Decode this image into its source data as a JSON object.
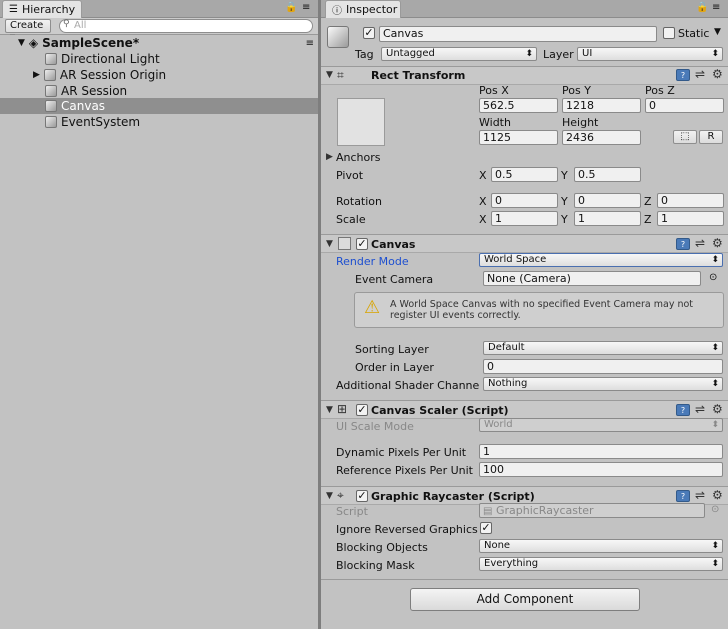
{
  "hierarchy": {
    "tab_label": "Hierarchy",
    "create_label": "Create",
    "search_placeholder": "All",
    "scene_name": "SampleScene*",
    "items": [
      {
        "label": "Directional Light"
      },
      {
        "label": "AR Session Origin"
      },
      {
        "label": "AR Session"
      },
      {
        "label": "Canvas"
      },
      {
        "label": "EventSystem"
      }
    ]
  },
  "inspector": {
    "tab_label": "Inspector",
    "object_name": "Canvas",
    "static_label": "Static",
    "tag_label": "Tag",
    "tag_value": "Untagged",
    "layer_label": "Layer",
    "layer_value": "UI",
    "rect_transform": {
      "title": "Rect Transform",
      "posx_label": "Pos X",
      "posy_label": "Pos Y",
      "posz_label": "Pos Z",
      "posx": "562.5",
      "posy": "1218",
      "posz": "0",
      "width_label": "Width",
      "height_label": "Height",
      "width": "1125",
      "height": "2436",
      "r_label": "R",
      "anchors_label": "Anchors",
      "pivot_label": "Pivot",
      "pivot_x": "0.5",
      "pivot_y": "0.5",
      "rotation_label": "Rotation",
      "rot_x": "0",
      "rot_y": "0",
      "rot_z": "0",
      "scale_label": "Scale",
      "scale_x": "1",
      "scale_y": "1",
      "scale_z": "1",
      "x": "X",
      "y": "Y",
      "z": "Z"
    },
    "canvas": {
      "title": "Canvas",
      "render_mode_label": "Render Mode",
      "render_mode_value": "World Space",
      "event_camera_label": "Event Camera",
      "event_camera_value": "None (Camera)",
      "warning": "A World Space Canvas with no specified Event Camera may not register UI events correctly.",
      "sorting_layer_label": "Sorting Layer",
      "sorting_layer_value": "Default",
      "order_label": "Order in Layer",
      "order_value": "0",
      "shader_label": "Additional Shader Channels",
      "shader_value": "Nothing"
    },
    "canvas_scaler": {
      "title": "Canvas Scaler (Script)",
      "scale_mode_label": "UI Scale Mode",
      "scale_mode_value": "World",
      "dyn_label": "Dynamic Pixels Per Unit",
      "dyn_value": "1",
      "ref_label": "Reference Pixels Per Unit",
      "ref_value": "100"
    },
    "raycaster": {
      "title": "Graphic Raycaster (Script)",
      "script_label": "Script",
      "script_value": "GraphicRaycaster",
      "ignore_label": "Ignore Reversed Graphics",
      "blocking_objects_label": "Blocking Objects",
      "blocking_objects_value": "None",
      "blocking_mask_label": "Blocking Mask",
      "blocking_mask_value": "Everything"
    },
    "add_component_label": "Add Component"
  },
  "colors": {
    "link_blue": "#1d4fd0",
    "panel_bg": "#c2c2c2",
    "selection": "#8f8f8f"
  }
}
